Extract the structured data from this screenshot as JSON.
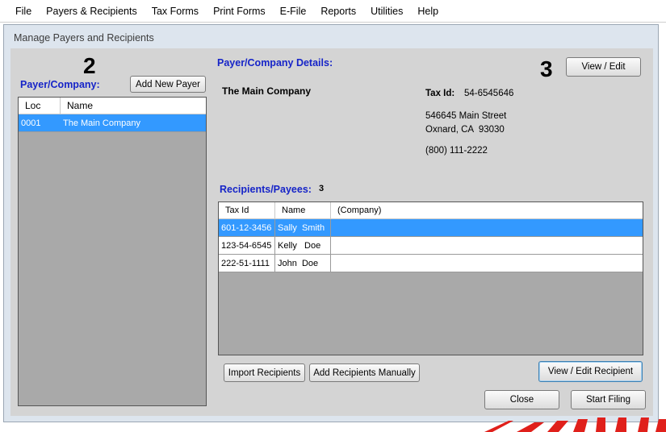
{
  "menu": [
    "File",
    "Payers & Recipients",
    "Tax Forms",
    "Print Forms",
    "E-File",
    "Reports",
    "Utilities",
    "Help"
  ],
  "window_title": "Manage Payers and Recipients",
  "step_left": "2",
  "step_right": "3",
  "payer": {
    "label": "Payer/Company:",
    "add_button": "Add New Payer",
    "columns": [
      "Loc",
      "Name"
    ],
    "rows": [
      {
        "loc": "0001",
        "name": "The Main Company"
      }
    ]
  },
  "details": {
    "label": "Payer/Company Details:",
    "view_button": "View / Edit",
    "company_name": "The Main Company",
    "tax_id_label": "Tax Id:",
    "tax_id": "54-6545646",
    "address1": "546645 Main Street",
    "address2": "Oxnard, CA  93030",
    "phone": "(800) 111-2222"
  },
  "recipients": {
    "label": "Recipients/Payees:",
    "count": "3",
    "columns": [
      "Tax Id",
      "Name",
      "(Company)"
    ],
    "rows": [
      {
        "tax_id": "601-12-3456",
        "name": "Sally  Smith",
        "company": ""
      },
      {
        "tax_id": "123-54-6545",
        "name": "Kelly   Doe",
        "company": ""
      },
      {
        "tax_id": "222-51-1111",
        "name": "John  Doe",
        "company": ""
      }
    ]
  },
  "buttons": {
    "import": "Import Recipients",
    "add_manual": "Add Recipients Manually",
    "view_recipient": "View / Edit Recipient",
    "close": "Close",
    "start_filing": "Start Filing"
  },
  "colors": {
    "selection": "#3399ff",
    "label_blue": "#1624c8",
    "logo_red": "#e0201b"
  }
}
